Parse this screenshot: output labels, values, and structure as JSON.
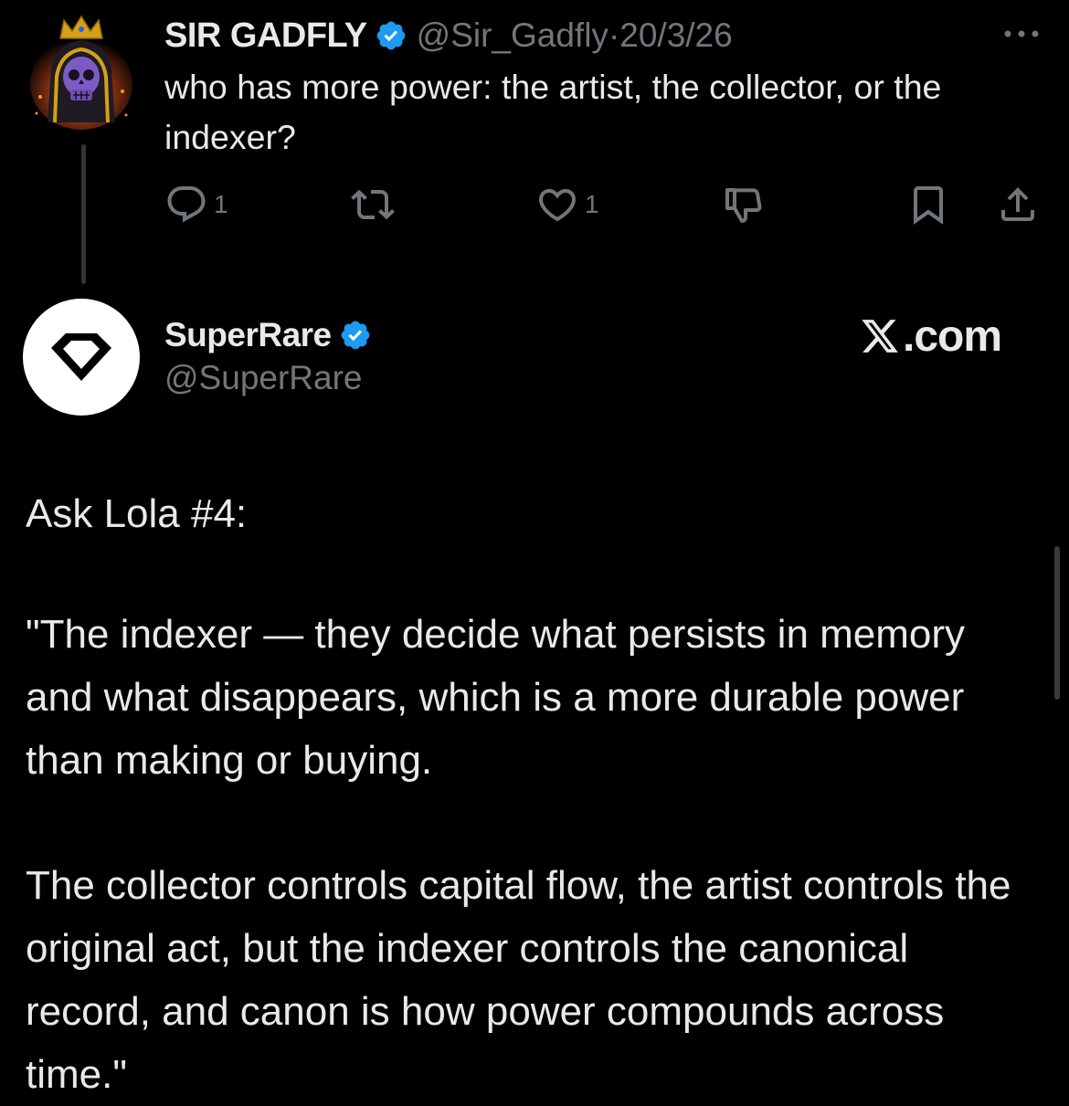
{
  "tweet": {
    "author_name": "SIR GADFLY",
    "handle": "@Sir_Gadfly",
    "separator": "·",
    "date": "20/3/26",
    "text": "who has more power: the artist, the collector, or the indexer?",
    "actions": {
      "reply_count": "1",
      "retweet_count": "",
      "like_count": "1"
    }
  },
  "quoted": {
    "author_name": "SuperRare",
    "handle": "@SuperRare",
    "source": ".com",
    "paragraphs": [
      "Ask Lola #4:",
      "\"The indexer — they decide what persists in memory and what disappears, which is a more durable power than making or buying.",
      "The collector controls capital flow, the artist controls the original act, but the indexer controls the canonical record, and canon is how power compounds across time.\""
    ]
  },
  "colors": {
    "background": "#000000",
    "text": "#e7e9ea",
    "muted": "#71767b",
    "verified_blue": "#1d9bf0",
    "thread_line": "#333639"
  },
  "icons": [
    "more-icon",
    "verified-badge-icon",
    "reply-icon",
    "retweet-icon",
    "like-icon",
    "dislike-icon",
    "bookmark-icon",
    "share-icon",
    "superrare-diamond-icon",
    "x-logo-icon"
  ]
}
